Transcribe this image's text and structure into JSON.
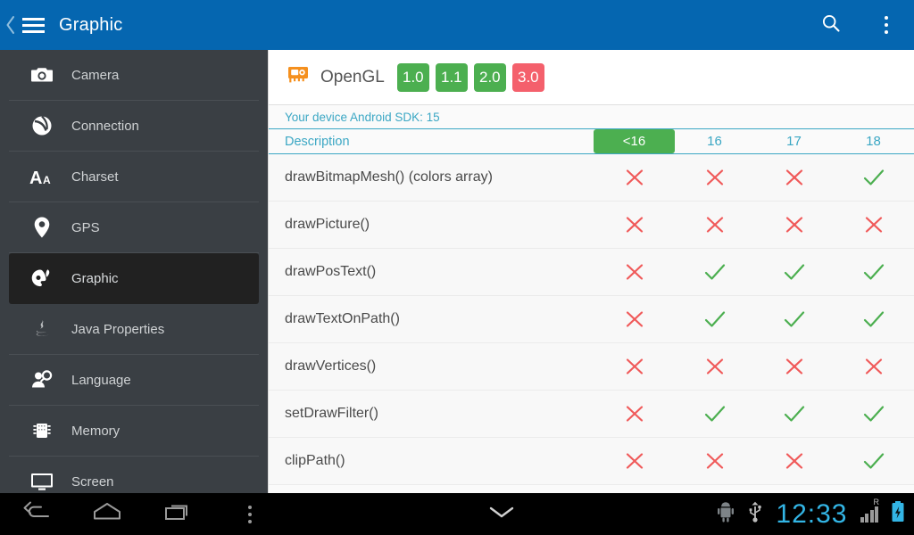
{
  "appbar": {
    "back_icon": "chevron-left-icon",
    "menu_icon": "hamburger-menu-icon",
    "title": "Graphic",
    "search_icon": "search-icon",
    "overflow_icon": "overflow-menu-icon",
    "background": "#0566b0"
  },
  "sidebar": {
    "background": "#3a3f44",
    "items": [
      {
        "label": "Camera",
        "icon": "camera-icon",
        "selected": false
      },
      {
        "label": "Connection",
        "icon": "connection-icon",
        "selected": false
      },
      {
        "label": "Charset",
        "icon": "charset-icon",
        "selected": false
      },
      {
        "label": "GPS",
        "icon": "gps-pin-icon",
        "selected": false
      },
      {
        "label": "Graphic",
        "icon": "graphic-palette-icon",
        "selected": true
      },
      {
        "label": "Java Properties",
        "icon": "java-icon",
        "selected": false
      },
      {
        "label": "Language",
        "icon": "language-icon",
        "selected": false
      },
      {
        "label": "Memory",
        "icon": "memory-chip-icon",
        "selected": false
      },
      {
        "label": "Screen",
        "icon": "screen-monitor-icon",
        "selected": false
      }
    ]
  },
  "opengl": {
    "icon": "graphics-card-icon",
    "icon_color": "#f5901e",
    "label": "OpenGL",
    "badges": [
      {
        "version": "1.0",
        "supported": true,
        "color": "#4caf50"
      },
      {
        "version": "1.1",
        "supported": true,
        "color": "#4caf50"
      },
      {
        "version": "2.0",
        "supported": true,
        "color": "#4caf50"
      },
      {
        "version": "3.0",
        "supported": false,
        "color": "#f4606c"
      }
    ]
  },
  "sdk_notice": "Your device Android SDK: 15",
  "table": {
    "accent_color": "#3ba7c4",
    "highlight_color": "#4caf50",
    "check_color": "#4caf50",
    "cross_color": "#f05a5a",
    "columns": [
      "Description",
      "<16",
      "16",
      "17",
      "18"
    ],
    "highlighted_column": "<16",
    "rows": [
      {
        "description": "drawBitmapMesh() (colors array)",
        "support": [
          false,
          false,
          false,
          true
        ]
      },
      {
        "description": "drawPicture()",
        "support": [
          false,
          false,
          false,
          false
        ]
      },
      {
        "description": "drawPosText()",
        "support": [
          false,
          true,
          true,
          true
        ]
      },
      {
        "description": "drawTextOnPath()",
        "support": [
          false,
          true,
          true,
          true
        ]
      },
      {
        "description": "drawVertices()",
        "support": [
          false,
          false,
          false,
          false
        ]
      },
      {
        "description": "setDrawFilter()",
        "support": [
          false,
          true,
          true,
          true
        ]
      },
      {
        "description": "clipPath()",
        "support": [
          false,
          false,
          false,
          true
        ]
      }
    ]
  },
  "navbar": {
    "back_icon": "nav-back-icon",
    "home_icon": "nav-home-icon",
    "recents_icon": "nav-recents-icon",
    "menu_icon": "nav-overflow-icon",
    "hide_icon": "nav-hide-keyboard-icon",
    "status": {
      "adb_icon": "android-debug-icon",
      "usb_icon": "usb-icon",
      "time": "12:33",
      "time_color": "#33b5e5",
      "signal_icon": "signal-bars-icon",
      "roaming_label": "R",
      "battery_icon": "battery-charging-icon"
    }
  }
}
